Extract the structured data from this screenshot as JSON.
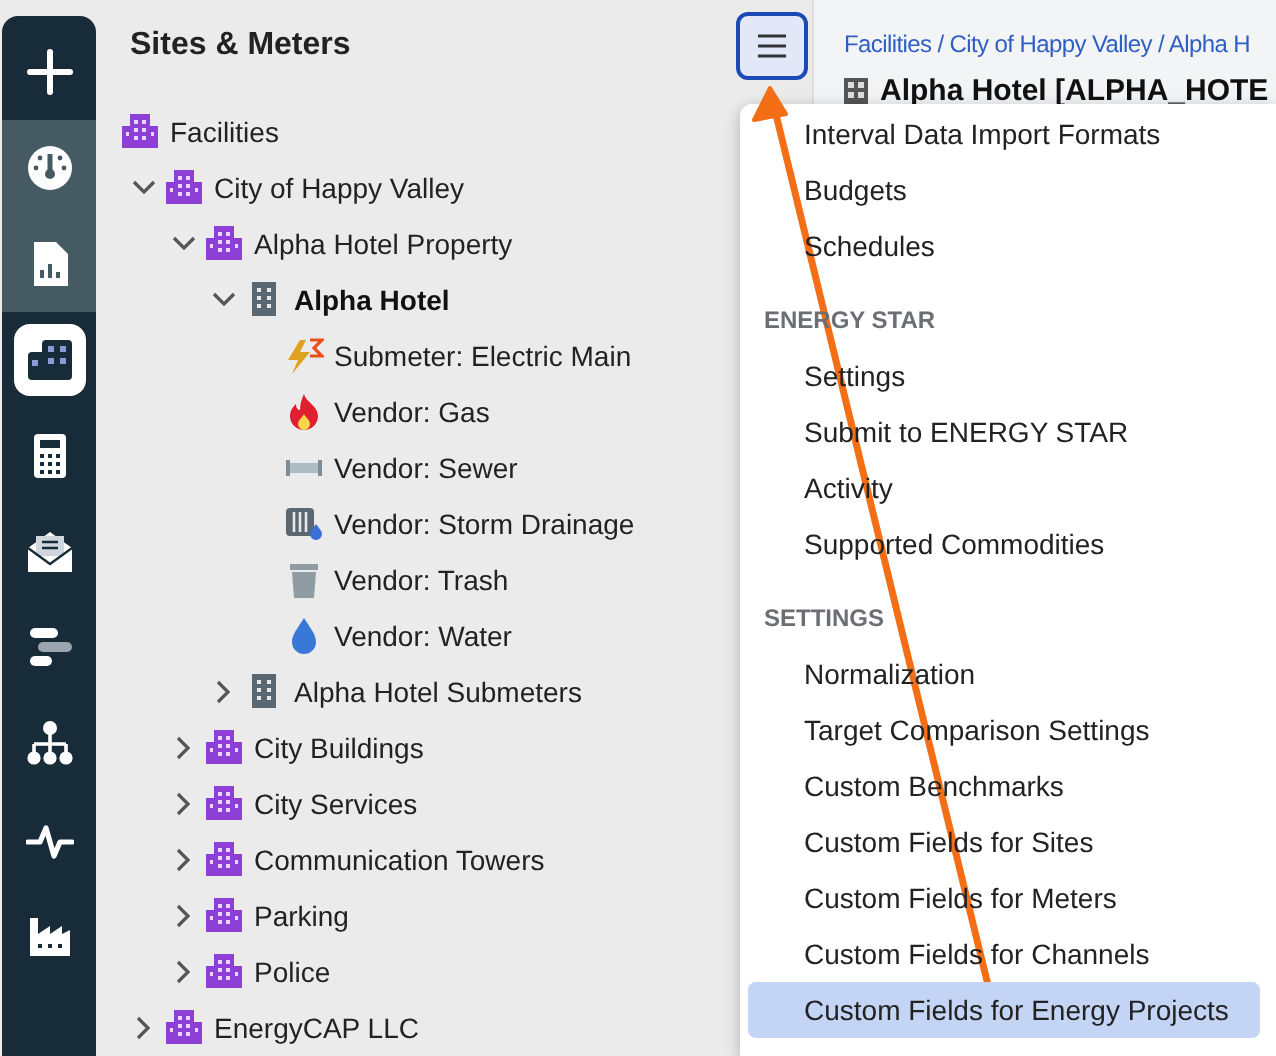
{
  "sidebar": {
    "items": [
      {
        "kind": "add",
        "selected": false
      },
      {
        "kind": "dashboard",
        "selected": false
      },
      {
        "kind": "reports",
        "selected": false
      },
      {
        "kind": "facilities",
        "selected": true
      },
      {
        "kind": "calculator",
        "selected": false
      },
      {
        "kind": "mail",
        "selected": false
      },
      {
        "kind": "gantt",
        "selected": false
      },
      {
        "kind": "hierarchy",
        "selected": false
      },
      {
        "kind": "pulse",
        "selected": false
      },
      {
        "kind": "factory",
        "selected": false
      }
    ]
  },
  "tree_panel": {
    "title": "Sites & Meters",
    "tree": [
      {
        "label": "Facilities",
        "kind": "org",
        "selected": false,
        "expanded": true,
        "children": [
          {
            "label": "City of Happy Valley",
            "kind": "org",
            "selected": false,
            "expanded": true,
            "children": [
              {
                "label": "Alpha Hotel Property",
                "kind": "org",
                "selected": false,
                "expanded": true,
                "children": [
                  {
                    "label": "Alpha Hotel",
                    "kind": "building",
                    "selected": true,
                    "expanded": true,
                    "children": [
                      {
                        "label": "Submeter: Electric Main",
                        "kind": "electric",
                        "selected": false
                      },
                      {
                        "label": "Vendor: Gas",
                        "kind": "gas",
                        "selected": false
                      },
                      {
                        "label": "Vendor: Sewer",
                        "kind": "sewer",
                        "selected": false
                      },
                      {
                        "label": "Vendor: Storm Drainage",
                        "kind": "storm",
                        "selected": false
                      },
                      {
                        "label": "Vendor: Trash",
                        "kind": "trash",
                        "selected": false
                      },
                      {
                        "label": "Vendor: Water",
                        "kind": "water",
                        "selected": false
                      }
                    ]
                  },
                  {
                    "label": "Alpha Hotel Submeters",
                    "kind": "building",
                    "selected": false,
                    "expanded": false
                  }
                ]
              },
              {
                "label": "City Buildings",
                "kind": "org",
                "selected": false,
                "expanded": false
              },
              {
                "label": "City Services",
                "kind": "org",
                "selected": false,
                "expanded": false
              },
              {
                "label": "Communication Towers",
                "kind": "org",
                "selected": false,
                "expanded": false
              },
              {
                "label": "Parking",
                "kind": "org",
                "selected": false,
                "expanded": false
              },
              {
                "label": "Police",
                "kind": "org",
                "selected": false,
                "expanded": false
              }
            ]
          },
          {
            "label": "EnergyCAP LLC",
            "kind": "org",
            "selected": false,
            "expanded": false
          }
        ]
      }
    ]
  },
  "breadcrumb": "Facilities / City of Happy Valley / Alpha H",
  "page_title": "Alpha Hotel [ALPHA_HOTE",
  "menu": {
    "sections": [
      {
        "items": [
          {
            "label": "Interval Data Import Formats",
            "selected": false
          },
          {
            "label": "Budgets",
            "selected": false
          },
          {
            "label": "Schedules",
            "selected": false
          }
        ]
      },
      {
        "heading": "ENERGY STAR",
        "items": [
          {
            "label": "Settings",
            "selected": false
          },
          {
            "label": "Submit to ENERGY STAR",
            "selected": false
          },
          {
            "label": "Activity",
            "selected": false
          },
          {
            "label": "Supported Commodities",
            "selected": false
          }
        ]
      },
      {
        "heading": "SETTINGS",
        "items": [
          {
            "label": "Normalization",
            "selected": false
          },
          {
            "label": "Target Comparison Settings",
            "selected": false
          },
          {
            "label": "Custom Benchmarks",
            "selected": false
          },
          {
            "label": "Custom Fields for Sites",
            "selected": false
          },
          {
            "label": "Custom Fields for Meters",
            "selected": false
          },
          {
            "label": "Custom Fields for Channels",
            "selected": false
          },
          {
            "label": "Custom Fields for Energy Projects",
            "selected": true
          }
        ]
      }
    ]
  }
}
